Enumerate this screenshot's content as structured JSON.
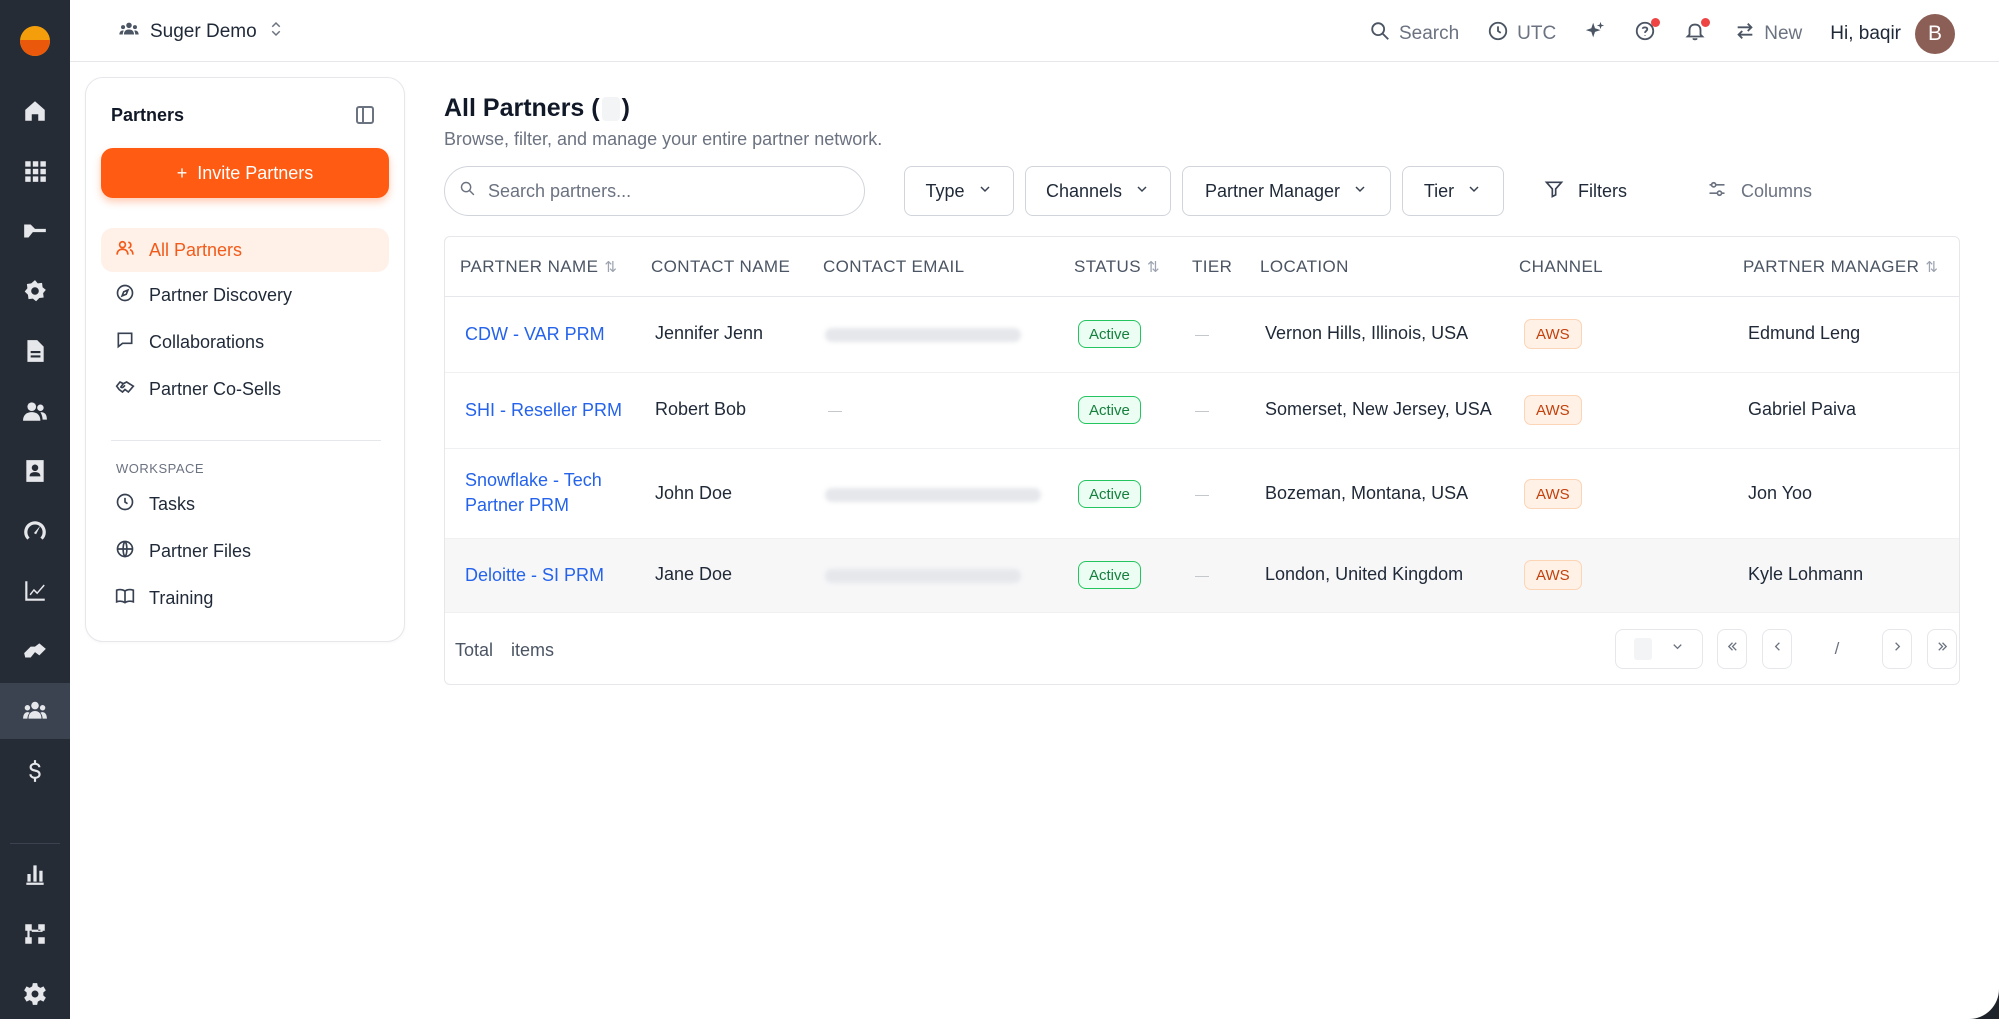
{
  "org": {
    "name": "Suger Demo"
  },
  "topbar": {
    "search_label": "Search",
    "timezone_label": "UTC",
    "new_label": "New",
    "greeting": "Hi, baqir",
    "avatar_initial": "B"
  },
  "panel": {
    "title": "Partners",
    "invite_label": "Invite Partners",
    "nav": [
      "All Partners",
      "Partner Discovery",
      "Collaborations",
      "Partner Co-Sells"
    ],
    "workspace_label": "WORKSPACE",
    "workspace": [
      "Tasks",
      "Partner Files",
      "Training"
    ]
  },
  "content": {
    "title": "All Partners",
    "subtitle": "Browse, filter, and manage your entire partner network.",
    "search_placeholder": "Search partners...",
    "filters": {
      "type": "Type",
      "channels": "Channels",
      "partner_manager": "Partner Manager",
      "tier": "Tier",
      "filters": "Filters",
      "columns": "Columns"
    }
  },
  "table": {
    "headers": [
      "PARTNER NAME",
      "CONTACT NAME",
      "CONTACT EMAIL",
      "STATUS",
      "TIER",
      "LOCATION",
      "CHANNEL",
      "PARTNER MANAGER"
    ],
    "rows": [
      {
        "name": "CDW - VAR PRM",
        "contact": "Jennifer Jenn",
        "status": "Active",
        "location": "Vernon Hills, Illinois, USA",
        "channel": "AWS",
        "manager": "Edmund Leng"
      },
      {
        "name": "SHI - Reseller PRM",
        "contact": "Robert Bob",
        "status": "Active",
        "location": "Somerset, New Jersey, USA",
        "channel": "AWS",
        "manager": "Gabriel Paiva"
      },
      {
        "name": "Snowflake - Tech Partner PRM",
        "contact": "John Doe",
        "status": "Active",
        "location": "Bozeman, Montana, USA",
        "channel": "AWS",
        "manager": "Jon Yoo"
      },
      {
        "name": "Deloitte - SI PRM",
        "contact": "Jane Doe",
        "status": "Active",
        "location": "London, United Kingdom",
        "channel": "AWS",
        "manager": "Kyle Lohmann"
      }
    ],
    "footer": {
      "total_label": "Total",
      "items_label": "items",
      "page_sep": "/"
    }
  },
  "colors": {
    "accent": "#ff5b12",
    "link": "#2563eb",
    "rail": "#262c36",
    "active_badge": "#15803d",
    "aws_badge": "#c2410c"
  },
  "icons": {
    "rail": [
      "home-icon",
      "apps-icon",
      "products-icon",
      "settings-gear-icon",
      "document-icon",
      "users-icon",
      "contacts-icon",
      "gauge-icon",
      "analytics-icon",
      "handshake-icon",
      "partners-icon",
      "dollar-icon",
      "bar-chart-icon",
      "workflow-icon",
      "gear-icon"
    ]
  }
}
